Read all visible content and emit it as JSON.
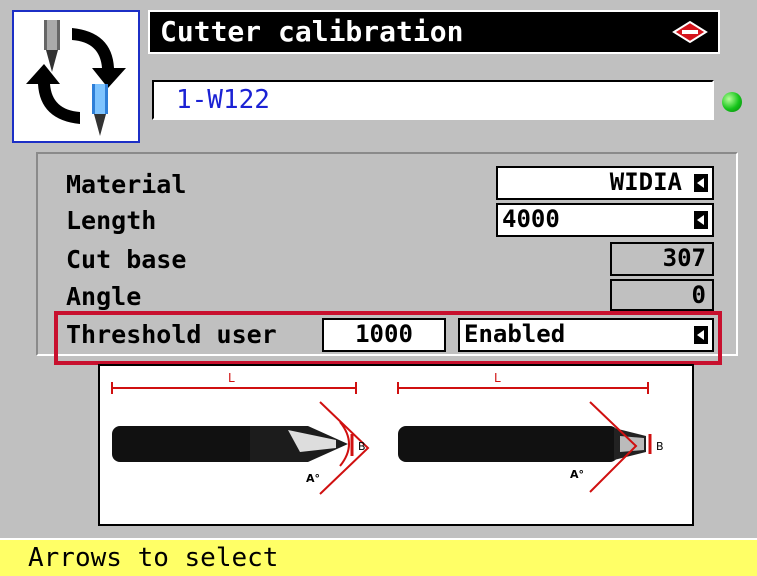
{
  "window": {
    "title": "Cutter calibration"
  },
  "cutter": {
    "code": "1-W122",
    "status_led_color": "#14c41a"
  },
  "fields": {
    "material_label": "Material",
    "material_value": "WIDIA",
    "length_label": "Length",
    "length_value": "4000",
    "cut_base_label": "Cut base",
    "cut_base_value": "307",
    "angle_label": "Angle",
    "angle_value": "0",
    "threshold_label": "Threshold user",
    "threshold_value": "1000",
    "threshold_state": "Enabled"
  },
  "diagram": {
    "length_mark_1": "L",
    "length_mark_2": "L",
    "angle_mark_1": "A°",
    "angle_mark_2": "A°",
    "base_mark_1": "B",
    "base_mark_2": "B"
  },
  "status": {
    "message": "Arrows to select"
  },
  "colors": {
    "accent_blue": "#1b22d4",
    "highlight_red": "#c8102e",
    "status_yellow": "#ffff66"
  }
}
